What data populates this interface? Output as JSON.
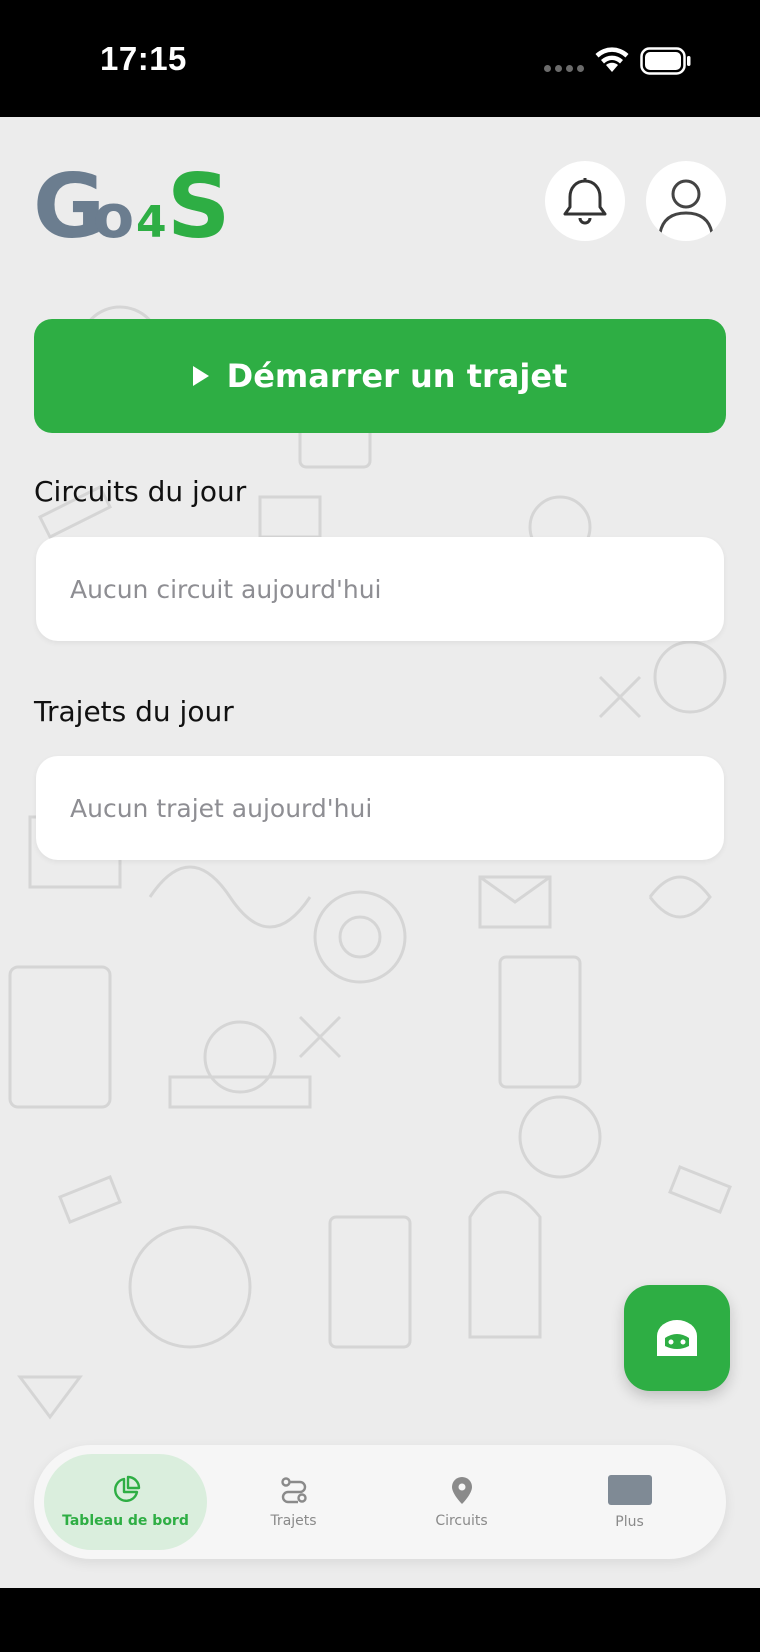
{
  "status_bar": {
    "time": "17:15"
  },
  "brand": {
    "logo_text_main": "Go",
    "logo_text_num": "4",
    "logo_text_end": "S"
  },
  "colors": {
    "accent": "#2eae44",
    "logo_gray": "#6b7d8f",
    "card_text": "#8e8e93"
  },
  "actions": {
    "start_trip_label": "Démarrer un trajet"
  },
  "sections": {
    "circuits": {
      "title": "Circuits du jour",
      "empty_text": "Aucun circuit aujourd'hui"
    },
    "trips": {
      "title": "Trajets du jour",
      "empty_text": "Aucun trajet aujourd'hui"
    }
  },
  "nav": {
    "items": [
      {
        "label": "Tableau de bord",
        "icon": "dashboard-icon",
        "active": true
      },
      {
        "label": "Trajets",
        "icon": "route-icon",
        "active": false
      },
      {
        "label": "Circuits",
        "icon": "location-pin-icon",
        "active": false
      },
      {
        "label": "Plus",
        "icon": "more-icon",
        "active": false
      }
    ]
  },
  "icons": {
    "bell": "bell-icon",
    "profile": "user-icon",
    "chat": "chat-bot-icon"
  }
}
